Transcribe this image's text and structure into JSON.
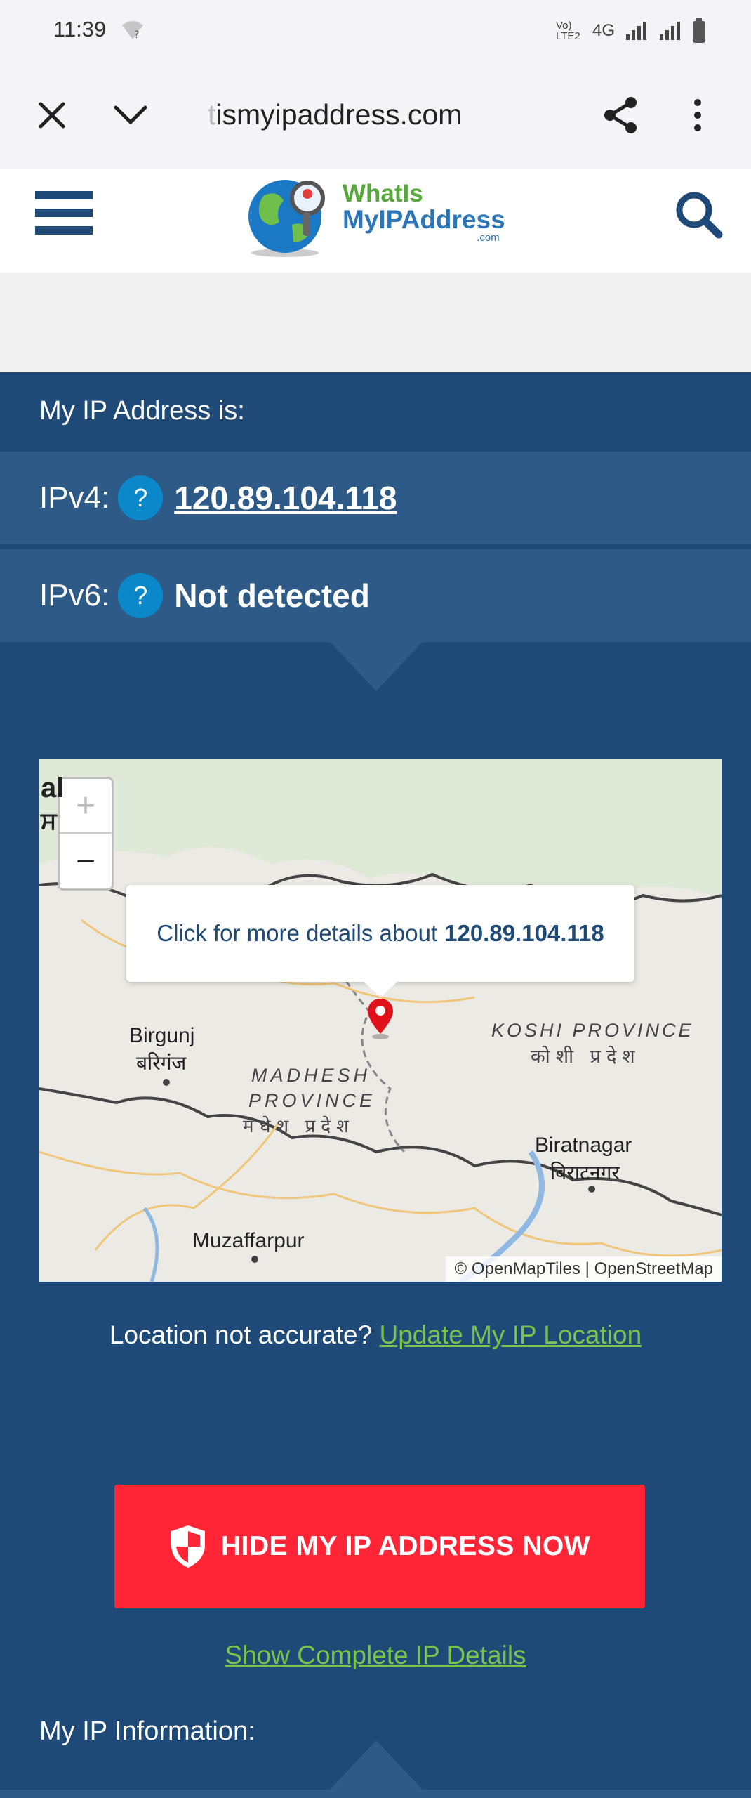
{
  "status_bar": {
    "time": "11:39",
    "network_label": "4G",
    "volte_label": "Vo) LTE2",
    "icons": [
      "wifi-question-icon",
      "signal-icon",
      "signal-icon",
      "battery-icon"
    ]
  },
  "browser": {
    "url_faded": "t",
    "url": "ismyipaddress.com",
    "icons": [
      "close-icon",
      "chevron-down-icon",
      "share-icon",
      "more-vert-icon"
    ]
  },
  "site": {
    "logo_line1": "WhatIs",
    "logo_line2": "MyIPAddress",
    "logo_com": ".com"
  },
  "ip_panel": {
    "heading": "My IP Address is:",
    "ipv4_label": "IPv4:",
    "ipv4_value": "120.89.104.118",
    "ipv6_label": "IPv6:",
    "ipv6_value": "Not detected",
    "help_glyph": "?"
  },
  "map": {
    "popup_text": "Click for more details about",
    "popup_ip": "120.89.104.118",
    "zoom_in": "+",
    "zoom_out": "−",
    "labels": {
      "birgunj": "Birgunj",
      "birgunj_hi": "बरिगंज",
      "madhesh1": "MADHESH",
      "madhesh2": "PROVINCE",
      "madhesh_hi": "मधेश प्रदेश",
      "koshi": "KOSHI PROVINCE",
      "koshi_hi": "कोशी प्रदेश",
      "biratnagar": "Biratnagar",
      "biratnagar_hi": "बिराटनगर",
      "muzaffarpur": "Muzaffarpur",
      "edge_top": "al",
      "edge_bot": "ਸ"
    },
    "attribution": "© OpenMapTiles | OpenStreetMap"
  },
  "location": {
    "prompt": "Location not accurate?",
    "link": "Update My IP Location"
  },
  "cta": {
    "hide_label": "HIDE MY IP ADDRESS NOW",
    "show_details": "Show Complete IP Details"
  },
  "info_heading": "My IP Information:",
  "colors": {
    "panel_bg": "#1f4a78",
    "row_bg": "#2d5a86",
    "help_btn": "#0a88c9",
    "cta_red": "#ff2537",
    "link_green": "#78c34e"
  }
}
